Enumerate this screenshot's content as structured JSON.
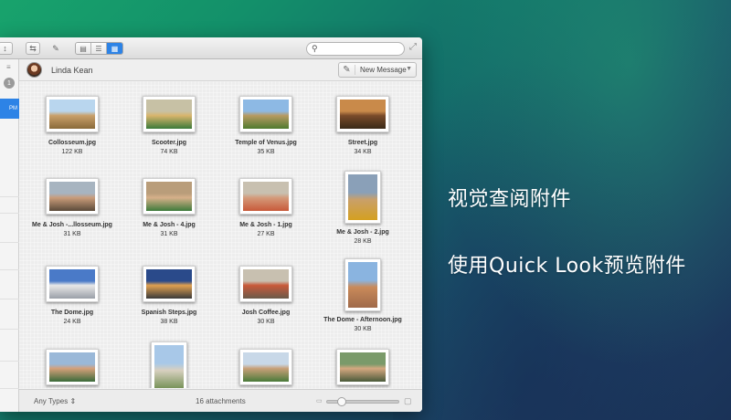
{
  "promo": {
    "line1": "视觉查阅附件",
    "line2": "使用Quick Look预览附件"
  },
  "toolbar": {
    "compose_icon": "compose-icon",
    "search_placeholder": "",
    "view_modes": [
      "list",
      "columns",
      "grid"
    ],
    "active_view": "grid"
  },
  "sidebar": {
    "unread_badge": "1",
    "selected_time": "PM"
  },
  "header": {
    "contact": "Linda Kean",
    "new_message": "New Message"
  },
  "attachments": [
    {
      "name": "Collosseum.jpg",
      "size": "122 KB",
      "orient": "l",
      "colors": [
        "#b9d6ee",
        "#c9a06a",
        "#8a6a3a"
      ]
    },
    {
      "name": "Scooter.jpg",
      "size": "74 KB",
      "orient": "l",
      "colors": [
        "#c7c1a5",
        "#d9b56c",
        "#3b7a3a"
      ]
    },
    {
      "name": "Temple of Venus.jpg",
      "size": "35 KB",
      "orient": "l",
      "colors": [
        "#8db9e4",
        "#b79a62",
        "#4f7a2e"
      ]
    },
    {
      "name": "Street.jpg",
      "size": "34 KB",
      "orient": "l",
      "colors": [
        "#c98a4a",
        "#7a4b2a",
        "#3a2a18"
      ]
    },
    {
      "name": "Me & Josh -...llosseum.jpg",
      "size": "31 KB",
      "orient": "l",
      "colors": [
        "#a7b4c0",
        "#c99c7a",
        "#5a4a3a"
      ]
    },
    {
      "name": "Me & Josh - 4.jpg",
      "size": "31 KB",
      "orient": "l",
      "colors": [
        "#b99d7a",
        "#d6b08a",
        "#3d7a3a"
      ]
    },
    {
      "name": "Me & Josh - 1.jpg",
      "size": "27 KB",
      "orient": "l",
      "colors": [
        "#c8c0b0",
        "#d49a7a",
        "#c85a3a"
      ]
    },
    {
      "name": "Me & Josh - 2.jpg",
      "size": "28 KB",
      "orient": "p",
      "colors": [
        "#8aa0b8",
        "#c9a06a",
        "#d4a020"
      ]
    },
    {
      "name": "The Dome.jpg",
      "size": "24 KB",
      "orient": "l",
      "colors": [
        "#4a7ac8",
        "#e8e8e8",
        "#9aa0a8"
      ]
    },
    {
      "name": "Spanish Steps.jpg",
      "size": "38 KB",
      "orient": "l",
      "colors": [
        "#2a4a8a",
        "#e0a050",
        "#3a3a3a"
      ]
    },
    {
      "name": "Josh Coffee.jpg",
      "size": "30 KB",
      "orient": "l",
      "colors": [
        "#c8c0b0",
        "#c85a3a",
        "#6a5a4a"
      ]
    },
    {
      "name": "The Dome - Afternoon.jpg",
      "size": "30 KB",
      "orient": "p",
      "colors": [
        "#8ab4e0",
        "#c98a5a",
        "#a06a4a"
      ]
    },
    {
      "name": "",
      "size": "",
      "orient": "l",
      "colors": [
        "#9ab8d8",
        "#d4a07a",
        "#3a6a3a"
      ]
    },
    {
      "name": "",
      "size": "",
      "orient": "p",
      "colors": [
        "#a8c8e8",
        "#d8d0c0",
        "#6a8a4a"
      ]
    },
    {
      "name": "",
      "size": "",
      "orient": "l",
      "colors": [
        "#c8d8e8",
        "#c8a078",
        "#4a7a3a"
      ]
    },
    {
      "name": "",
      "size": "",
      "orient": "l",
      "colors": [
        "#7a9a6a",
        "#d4a880",
        "#4a5a3a"
      ]
    }
  ],
  "footer": {
    "types": "Any Types",
    "count": "16 attachments",
    "zoom_level": 0.15
  }
}
